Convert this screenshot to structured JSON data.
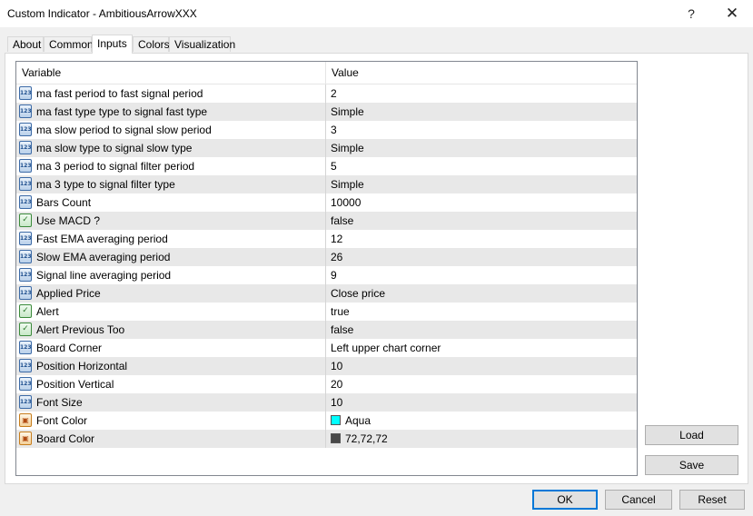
{
  "window": {
    "title": "Custom Indicator - AmbitiousArrowXXX",
    "help_glyph": "?",
    "close_glyph": "✕"
  },
  "tabs": [
    "About",
    "Common",
    "Inputs",
    "Colors",
    "Visualization"
  ],
  "active_tab": "Inputs",
  "grid": {
    "header_variable": "Variable",
    "header_value": "Value",
    "rows": [
      {
        "icon": "numeric-icon",
        "label": "ma fast period to fast signal period",
        "value": "2"
      },
      {
        "icon": "numeric-icon",
        "label": "ma fast type type to signal fast type",
        "value": "Simple"
      },
      {
        "icon": "numeric-icon",
        "label": "ma slow period to signal slow period",
        "value": "3"
      },
      {
        "icon": "numeric-icon",
        "label": "ma slow type to signal slow type",
        "value": "Simple"
      },
      {
        "icon": "numeric-icon",
        "label": "ma 3 period to signal filter period",
        "value": "5"
      },
      {
        "icon": "numeric-icon",
        "label": "ma 3 type to signal filter type",
        "value": "Simple"
      },
      {
        "icon": "numeric-icon",
        "label": "Bars Count",
        "value": "10000"
      },
      {
        "icon": "boolean-icon",
        "label": "Use MACD ?",
        "value": "false"
      },
      {
        "icon": "numeric-icon",
        "label": "Fast EMA averaging period",
        "value": "12"
      },
      {
        "icon": "numeric-icon",
        "label": "Slow EMA averaging period",
        "value": "26"
      },
      {
        "icon": "numeric-icon",
        "label": "Signal line averaging period",
        "value": "9"
      },
      {
        "icon": "numeric-icon",
        "label": "Applied Price",
        "value": "Close price"
      },
      {
        "icon": "boolean-icon",
        "label": "Alert",
        "value": "true"
      },
      {
        "icon": "boolean-icon",
        "label": "Alert Previous Too",
        "value": "false"
      },
      {
        "icon": "numeric-icon",
        "label": "Board Corner",
        "value": "Left upper chart corner"
      },
      {
        "icon": "numeric-icon",
        "label": "Position Horizontal",
        "value": "10"
      },
      {
        "icon": "numeric-icon",
        "label": "Position Vertical",
        "value": "20"
      },
      {
        "icon": "numeric-icon",
        "label": "Font Size",
        "value": "10"
      },
      {
        "icon": "color-icon",
        "label": "Font Color",
        "value": "Aqua",
        "swatch": "#00ffff"
      },
      {
        "icon": "color-icon",
        "label": "Board Color",
        "value": "72,72,72",
        "swatch": "#484848"
      }
    ]
  },
  "buttons": {
    "load": "Load",
    "save": "Save",
    "ok": "OK",
    "cancel": "Cancel",
    "reset": "Reset"
  },
  "colors": {
    "alt_row": "#e8e8e8",
    "accent": "#0078d7"
  }
}
